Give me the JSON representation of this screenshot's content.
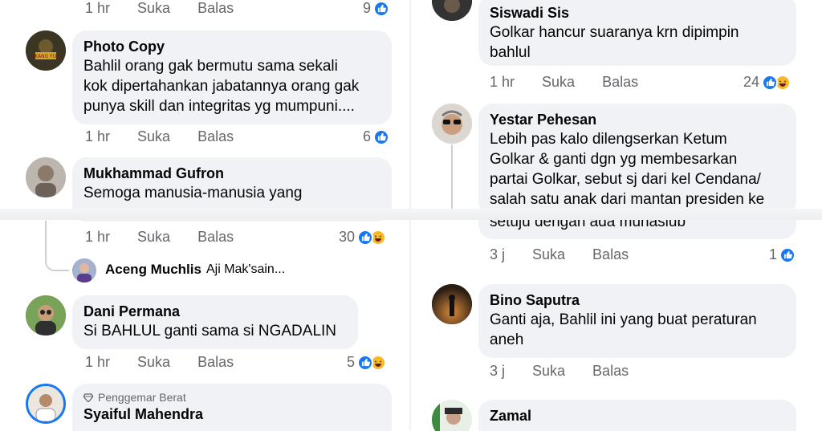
{
  "actions": {
    "like": "Suka",
    "reply": "Balas"
  },
  "left": {
    "top_row": {
      "time": "1 hr",
      "count": "9"
    },
    "comments": [
      {
        "author": "Photo Copy",
        "avatar_text": "TUKANG FOTO",
        "lines": [
          "Bahlil orang gak bermutu sama sekali",
          "kok dipertahankan jabatannya orang gak",
          "punya skill dan integritas yg mumpuni...."
        ],
        "time": "1 hr",
        "count": "6"
      },
      {
        "author": "Mukhammad Gufron",
        "lines": [
          "Semoga manusia-manusia yang"
        ]
      },
      {
        "time": "1 hr",
        "count": "30"
      },
      {
        "author": "Dani Permana",
        "lines": [
          "Si BAHLUL ganti sama si NGADALIN"
        ],
        "time": "1 hr",
        "count": "5"
      },
      {
        "badge": "Penggemar Berat",
        "author": "Syaiful Mahendra"
      }
    ],
    "reply_preview": {
      "name": "Aceng Muchlis",
      "text": "Aji Mak'sain..."
    }
  },
  "right": {
    "comments": [
      {
        "author": "Siswadi Sis",
        "lines": [
          "Golkar hancur suaranya krn dipimpin",
          "bahlul"
        ],
        "time": "1 hr",
        "count": "24"
      },
      {
        "author": "Yestar Pehesan",
        "lines": [
          "Lebih pas kalo dilengserkan Ketum",
          "Golkar & ganti dgn yg membesarkan",
          "partai Golkar, sebut sj dari kel Cendana/",
          "salah satu anak dari mantan presiden ke"
        ]
      },
      {
        "lines": [
          "setuju dengan ada munasiub"
        ],
        "time": "3 j",
        "count": "1"
      },
      {
        "author": "Bino Saputra",
        "lines": [
          "Ganti aja, Bahlil ini yang buat peraturan",
          "aneh"
        ],
        "time": "3 j"
      },
      {
        "author": "Zamal"
      }
    ]
  },
  "colors": {
    "bubble": "#f0f2f5",
    "like_blue": "#1877f2",
    "haha_yellow": "#f7b928",
    "meta_gray": "#65676b"
  },
  "icons": [
    "like-icon",
    "haha-icon",
    "gem-icon"
  ]
}
